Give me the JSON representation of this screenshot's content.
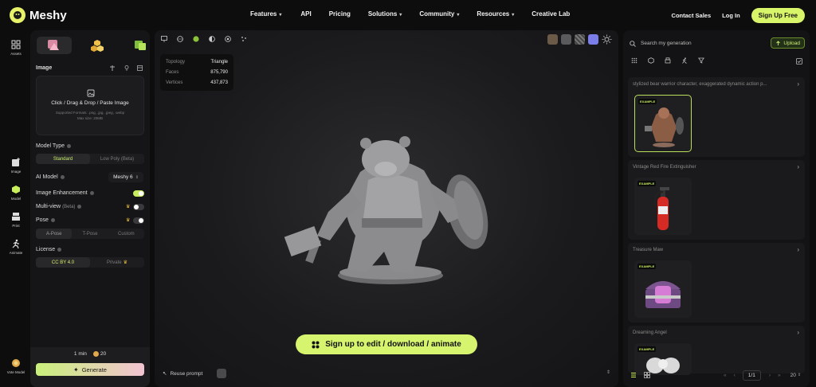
{
  "brand": {
    "name": "Meshy"
  },
  "nav": {
    "items": [
      {
        "label": "Features",
        "caret": true
      },
      {
        "label": "API",
        "caret": false
      },
      {
        "label": "Pricing",
        "caret": false
      },
      {
        "label": "Solutions",
        "caret": true
      },
      {
        "label": "Community",
        "caret": true
      },
      {
        "label": "Resources",
        "caret": true
      },
      {
        "label": "Creative Lab",
        "caret": false
      }
    ],
    "contact": "Contact Sales",
    "login": "Log In",
    "signup": "Sign Up Free"
  },
  "rail": {
    "assets": "Assets",
    "image": "Image",
    "model": "Model",
    "print": "Print",
    "animate": "Animate",
    "vote": "Vote Model"
  },
  "left": {
    "image_label": "Image",
    "drop_title": "Click / Drag & Drop / Paste Image",
    "drop_formats": "Supported Formats: .png, .jpg, .jpeg, .webp",
    "drop_size": "Max size: 20MB",
    "model_type_label": "Model Type",
    "model_type_options": [
      "Standard",
      "Low Poly (Beta)"
    ],
    "ai_model_label": "AI Model",
    "ai_model_value": "Meshy 6",
    "image_enhancement_label": "Image Enhancement",
    "multiview_label": "Multi-view",
    "multiview_beta": "(Beta)",
    "pose_label": "Pose",
    "pose_options": [
      "A-Pose",
      "T-Pose",
      "Custom"
    ],
    "license_label": "License",
    "license_options": [
      "CC BY 4.0",
      "Private"
    ],
    "time": "1 min",
    "credits": "20",
    "generate": "Generate"
  },
  "viewport": {
    "stats": [
      {
        "k": "Topology",
        "v": "Triangle"
      },
      {
        "k": "Faces",
        "v": "875,790"
      },
      {
        "k": "Vertices",
        "v": "437,873"
      }
    ],
    "cta": "Sign up to edit / download / animate",
    "reuse": "Reuse prompt"
  },
  "right": {
    "search_placeholder": "Search my generation",
    "upload": "Upload",
    "badge": "EXAMPLE",
    "cards": [
      {
        "title": "stylized bear warrior character, exaggerated dynamic action p..."
      },
      {
        "title": "Vintage Red Fire Extinguisher"
      },
      {
        "title": "Treasure Maw"
      },
      {
        "title": "Dreaming Angel"
      }
    ],
    "page": "1/1",
    "per_page": "20"
  },
  "colors": {
    "accent": "#d6f46e",
    "bg": "#0d0d0e"
  }
}
